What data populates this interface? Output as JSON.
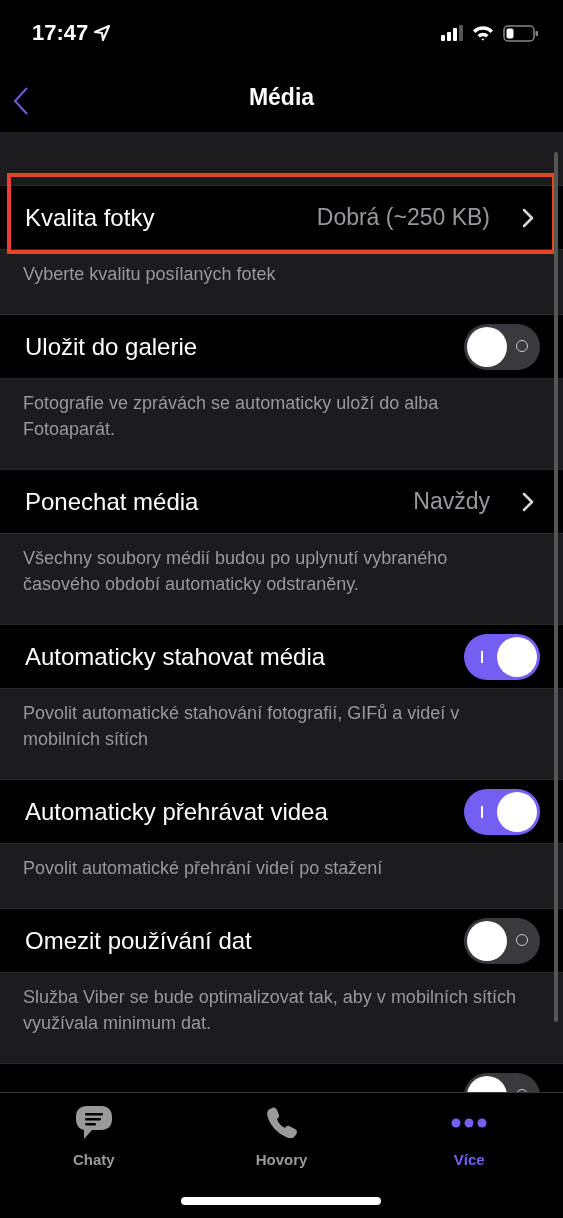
{
  "status_bar": {
    "time": "17:47"
  },
  "nav": {
    "title": "Média"
  },
  "sections": [
    {
      "kind": "disclosure",
      "label": "Kvalita fotky",
      "value": "Dobrá (~250 KB)",
      "highlighted": true,
      "footer": "Vyberte kvalitu posílaných fotek"
    },
    {
      "kind": "toggle",
      "label": "Uložit do galerie",
      "on": false,
      "footer": "Fotografie ve zprávách se automaticky uloží do alba Fotoaparát."
    },
    {
      "kind": "disclosure",
      "label": "Ponechat média",
      "value": "Navždy",
      "footer": "Všechny soubory médií budou po uplynutí vybraného časového období automaticky odstraněny."
    },
    {
      "kind": "toggle",
      "label": "Automaticky stahovat média",
      "on": true,
      "footer": "Povolit automatické stahování fotografií, GIFů a videí v mobilních sítích"
    },
    {
      "kind": "toggle",
      "label": "Automaticky přehrávat videa",
      "on": true,
      "footer": "Povolit automatické přehrání videí po stažení"
    },
    {
      "kind": "toggle",
      "label": "Omezit používání dat",
      "on": false,
      "footer": "Služba Viber se bude optimalizovat tak, aby v mobilních sítích využívala minimum dat."
    },
    {
      "kind": "toggle",
      "on": false
    }
  ],
  "tabs": [
    {
      "kind": "chats",
      "label": "Chaty",
      "selected": false
    },
    {
      "kind": "calls",
      "label": "Hovory",
      "selected": false
    },
    {
      "kind": "more",
      "label": "Více",
      "selected": true
    }
  ]
}
